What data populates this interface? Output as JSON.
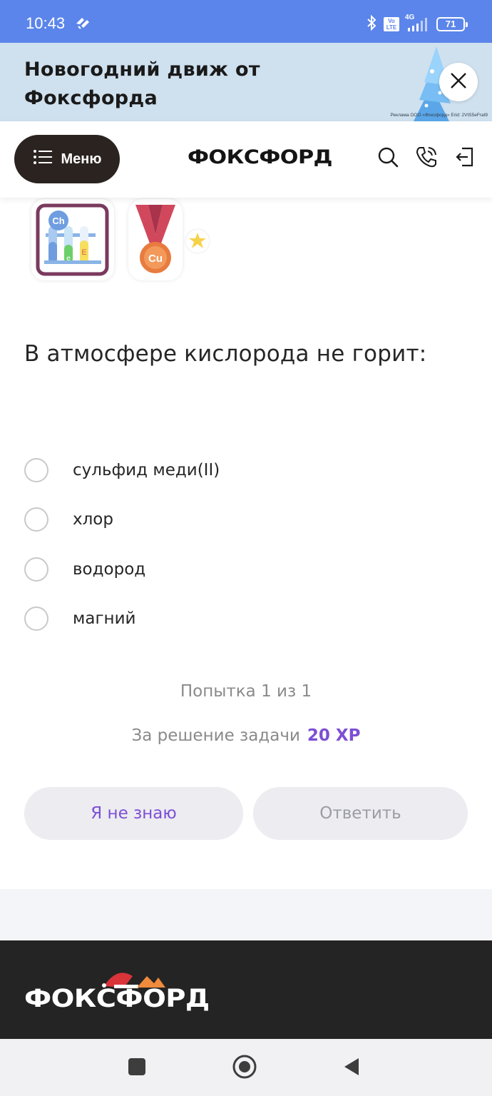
{
  "status_bar": {
    "time": "10:43",
    "network_badge": "Vo LTE",
    "network_type": "4G",
    "battery": "71"
  },
  "promo": {
    "title": "Новогодний движ от Фоксфорда",
    "legal": "Реклама ООО «Фоксфорд» Erid: 2VtS5eFrat9",
    "bg_color": "#cfe0ee"
  },
  "header": {
    "menu_label": "Меню",
    "brand": "ФОКСФОРД"
  },
  "badges": {
    "medal_label": "Cu",
    "flask_label": "Ch",
    "flask_tube_letter_1": "e",
    "flask_tube_letter_2": "E"
  },
  "task": {
    "question": "В атмосфере кислорода не горит:",
    "options": [
      {
        "label": "сульфид меди(II)"
      },
      {
        "label": "хлор"
      },
      {
        "label": "водород"
      },
      {
        "label": "магний"
      }
    ],
    "attempt": "Попытка 1 из 1",
    "reward_text": "За решение задачи",
    "reward_xp": "20 XP",
    "dont_know_label": "Я не знаю",
    "answer_label": "Ответить",
    "accent_color": "#7d4fd4"
  },
  "footer": {
    "brand": "ФОКСФОРД"
  }
}
